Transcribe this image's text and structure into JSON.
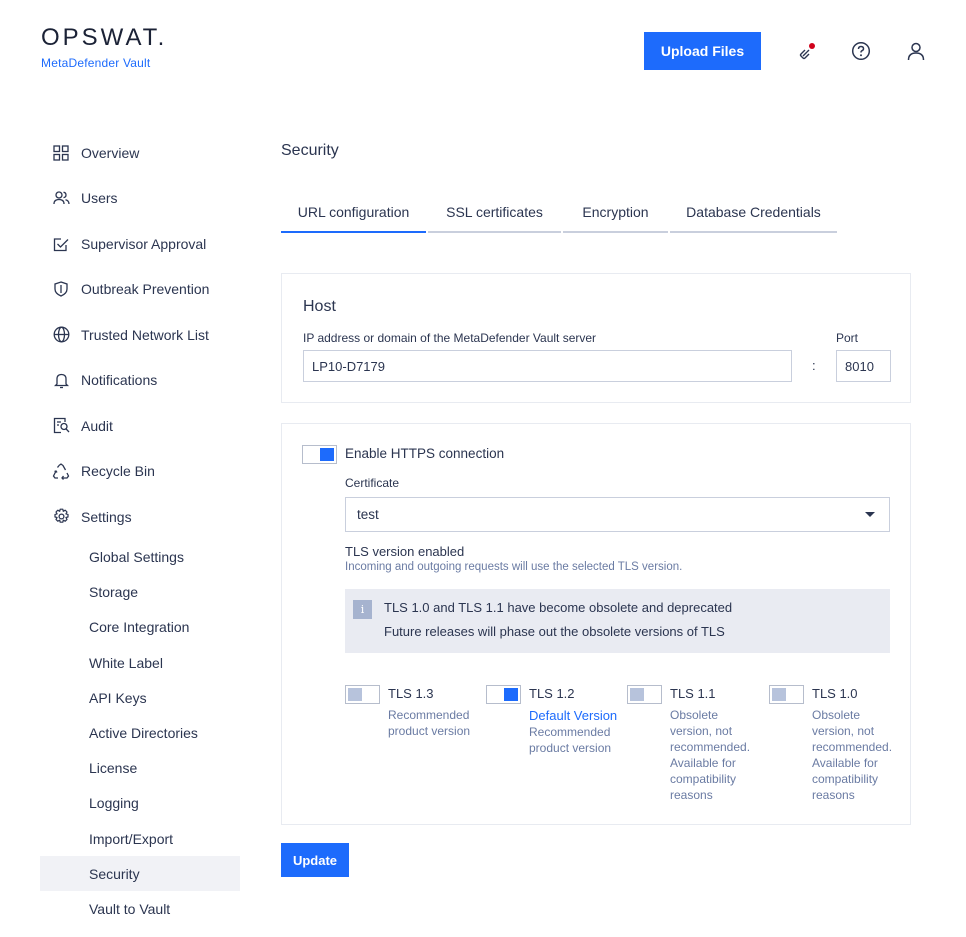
{
  "header": {
    "logo_text": "OPSWAT.",
    "product_name": "MetaDefender Vault",
    "upload_label": "Upload Files",
    "icons": [
      "integrations-icon",
      "help-icon",
      "user-icon"
    ],
    "notification_dot_color": "#d0021b"
  },
  "sidebar": {
    "items": [
      {
        "label": "Overview",
        "icon": "grid-icon"
      },
      {
        "label": "Users",
        "icon": "users-icon"
      },
      {
        "label": "Supervisor Approval",
        "icon": "approval-icon"
      },
      {
        "label": "Outbreak Prevention",
        "icon": "shield-icon"
      },
      {
        "label": "Trusted Network List",
        "icon": "globe-icon"
      },
      {
        "label": "Notifications",
        "icon": "bell-icon"
      },
      {
        "label": "Audit",
        "icon": "audit-icon"
      },
      {
        "label": "Recycle Bin",
        "icon": "recycle-icon"
      },
      {
        "label": "Settings",
        "icon": "gear-icon"
      }
    ],
    "sub_items": [
      {
        "label": "Global Settings"
      },
      {
        "label": "Storage"
      },
      {
        "label": "Core Integration"
      },
      {
        "label": "White Label"
      },
      {
        "label": "API Keys"
      },
      {
        "label": "Active Directories"
      },
      {
        "label": "License"
      },
      {
        "label": "Logging"
      },
      {
        "label": "Import/Export"
      },
      {
        "label": "Security",
        "active": true
      },
      {
        "label": "Vault to Vault"
      }
    ]
  },
  "main": {
    "title": "Security",
    "tabs": [
      {
        "label": "URL configuration",
        "active": true
      },
      {
        "label": "SSL certificates"
      },
      {
        "label": "Encryption"
      },
      {
        "label": "Database Credentials"
      }
    ],
    "host": {
      "title": "Host",
      "address_label": "IP address or domain of the MetaDefender Vault server",
      "address_value": "LP10-D7179",
      "separator": ":",
      "port_label": "Port",
      "port_value": "8010"
    },
    "https": {
      "enable_label": "Enable HTTPS connection",
      "enabled": true,
      "certificate_label": "Certificate",
      "certificate_value": "test",
      "tls_heading": "TLS version enabled",
      "tls_hint": "Incoming and outgoing requests will use the selected TLS version.",
      "notice_icon": "i",
      "notice_line1": "TLS 1.0 and TLS 1.1 have become obsolete and deprecated",
      "notice_line2": "Future releases will phase out the obsolete versions of TLS",
      "tls_options": [
        {
          "name": "TLS 1.3",
          "enabled": false,
          "default_label": "",
          "description": "Recommended product version"
        },
        {
          "name": "TLS 1.2",
          "enabled": true,
          "default_label": "Default Version",
          "description": "Recommended product version"
        },
        {
          "name": "TLS 1.1",
          "enabled": false,
          "default_label": "",
          "description": "Obsolete version, not recommended. Available for compatibility reasons"
        },
        {
          "name": "TLS 1.0",
          "enabled": false,
          "default_label": "",
          "description": "Obsolete version, not recommended. Available for compatibility reasons"
        }
      ]
    },
    "update_label": "Update"
  },
  "colors": {
    "accent": "#1d6bfc",
    "text": "#2b3550",
    "muted_text": "#6a7ba3",
    "active_nav_bg": "#f1f2f6",
    "notice_bg": "#e9ebf2"
  }
}
